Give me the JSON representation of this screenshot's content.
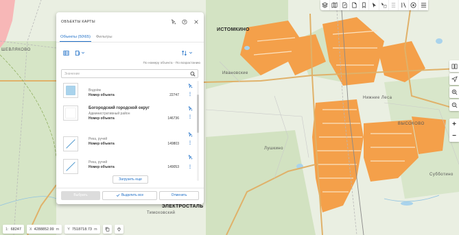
{
  "map": {
    "labels": {
      "istomkino": "ИСТОМКИНО",
      "shevlakovo": "ШЕВЛЯКОВО",
      "vysokovo": "ВЫСОКОВО",
      "elektrostal": "ЭЛЕКТРОСТАЛЬ",
      "lushkino": "Лушкино",
      "subbotino": "Субботино",
      "ivanovskie": "Ивановские",
      "timokhovskiy": "Тимоховский",
      "nizhnie": "Нижние Леса"
    }
  },
  "panel": {
    "title": "ОБЪЕКТЫ КАРТЫ",
    "tabs": [
      {
        "label": "Объекты (50\\65)",
        "active": true
      },
      {
        "label": "Фильтры",
        "active": false
      }
    ],
    "sort_caption": "По номеру объекта - По возрастанию",
    "search": {
      "placeholder": "Значение",
      "value": ""
    },
    "items": [
      {
        "title": "",
        "type": "Водоём",
        "num_label": "Номер объекта",
        "num_value": "22747",
        "thumb": "water"
      },
      {
        "title": "Богородский городской округ",
        "type": "Административный район",
        "num_label": "Номер объекта",
        "num_value": "146736",
        "thumb": "area"
      },
      {
        "title": "",
        "type": "Река, ручей",
        "num_label": "Номер объекта",
        "num_value": "149803",
        "thumb": "line"
      },
      {
        "title": "",
        "type": "Река, ручей",
        "num_label": "Номер объекта",
        "num_value": "149053",
        "thumb": "line"
      }
    ],
    "load_more": "Загрузить еще",
    "footer": {
      "choose": "Выбрать",
      "select_all": "Выделить все",
      "cancel": "Отменить"
    }
  },
  "status": {
    "scale_label": "1:",
    "scale_value": "68247",
    "x_label": "X",
    "x_value": "4288852.99",
    "x_unit": "m",
    "y_label": "Y",
    "y_value": "7518718.73",
    "y_unit": "m"
  },
  "colors": {
    "accent": "#1e6fc7",
    "urban": "#f4a04a",
    "forest": "#cfe0bf",
    "water": "#a9d3ec"
  },
  "icons": {
    "top_toolbar": [
      "layers-icon",
      "map-icon",
      "export-icon",
      "document-icon",
      "bookmark-icon",
      "select-icon",
      "select-area-icon",
      "list-icon",
      "ruler-icon",
      "info-icon",
      "menu-icon"
    ],
    "right_toolbar": [
      "book-icon",
      "navigate-icon",
      "zoom-area-icon",
      "zoom-out-area-icon"
    ]
  }
}
